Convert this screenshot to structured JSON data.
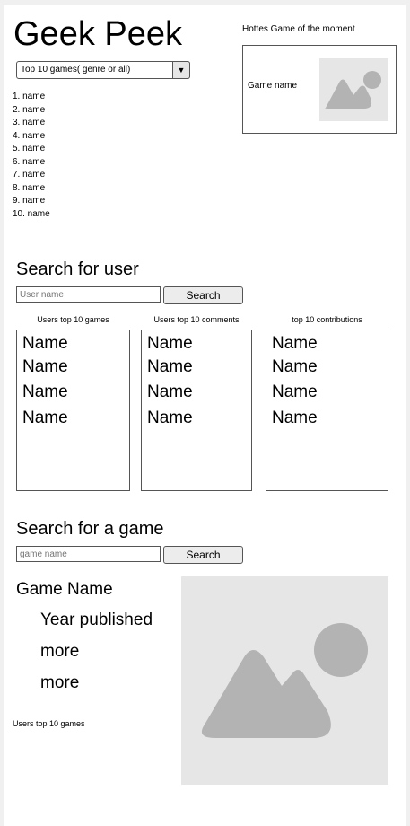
{
  "app": {
    "title": "Geek Peek"
  },
  "top_games": {
    "dropdown_label": "Top 10 games( genre or all)",
    "items": [
      "1. name",
      "2. name",
      "3. name",
      "4. name",
      "5. name",
      "6. name",
      "7. name",
      "8. name",
      "9. name",
      "10. name"
    ]
  },
  "hottest": {
    "label": "Hottes Game of the moment",
    "game_name": "Game name",
    "image_icon": "image-placeholder-icon"
  },
  "user_search": {
    "title": "Search for user",
    "placeholder": "User name",
    "button_label": "Search",
    "columns": [
      {
        "label": "Users top 10 games",
        "names": [
          "Name",
          "Name",
          "Name",
          "Name"
        ]
      },
      {
        "label": "Users top 10 comments",
        "names": [
          "Name",
          "Name",
          "Name",
          "Name"
        ]
      },
      {
        "label": "top 10 contributions",
        "names": [
          "Name",
          "Name",
          "Name",
          "Name"
        ]
      }
    ]
  },
  "game_search": {
    "title": "Search for a game",
    "placeholder": "game name",
    "button_label": "Search",
    "result": {
      "game_name": "Game Name",
      "year_published": "Year published",
      "more_1": "more",
      "more_2": "more",
      "users_top_label": "Users top 10 games",
      "image_icon": "image-placeholder-icon"
    }
  }
}
